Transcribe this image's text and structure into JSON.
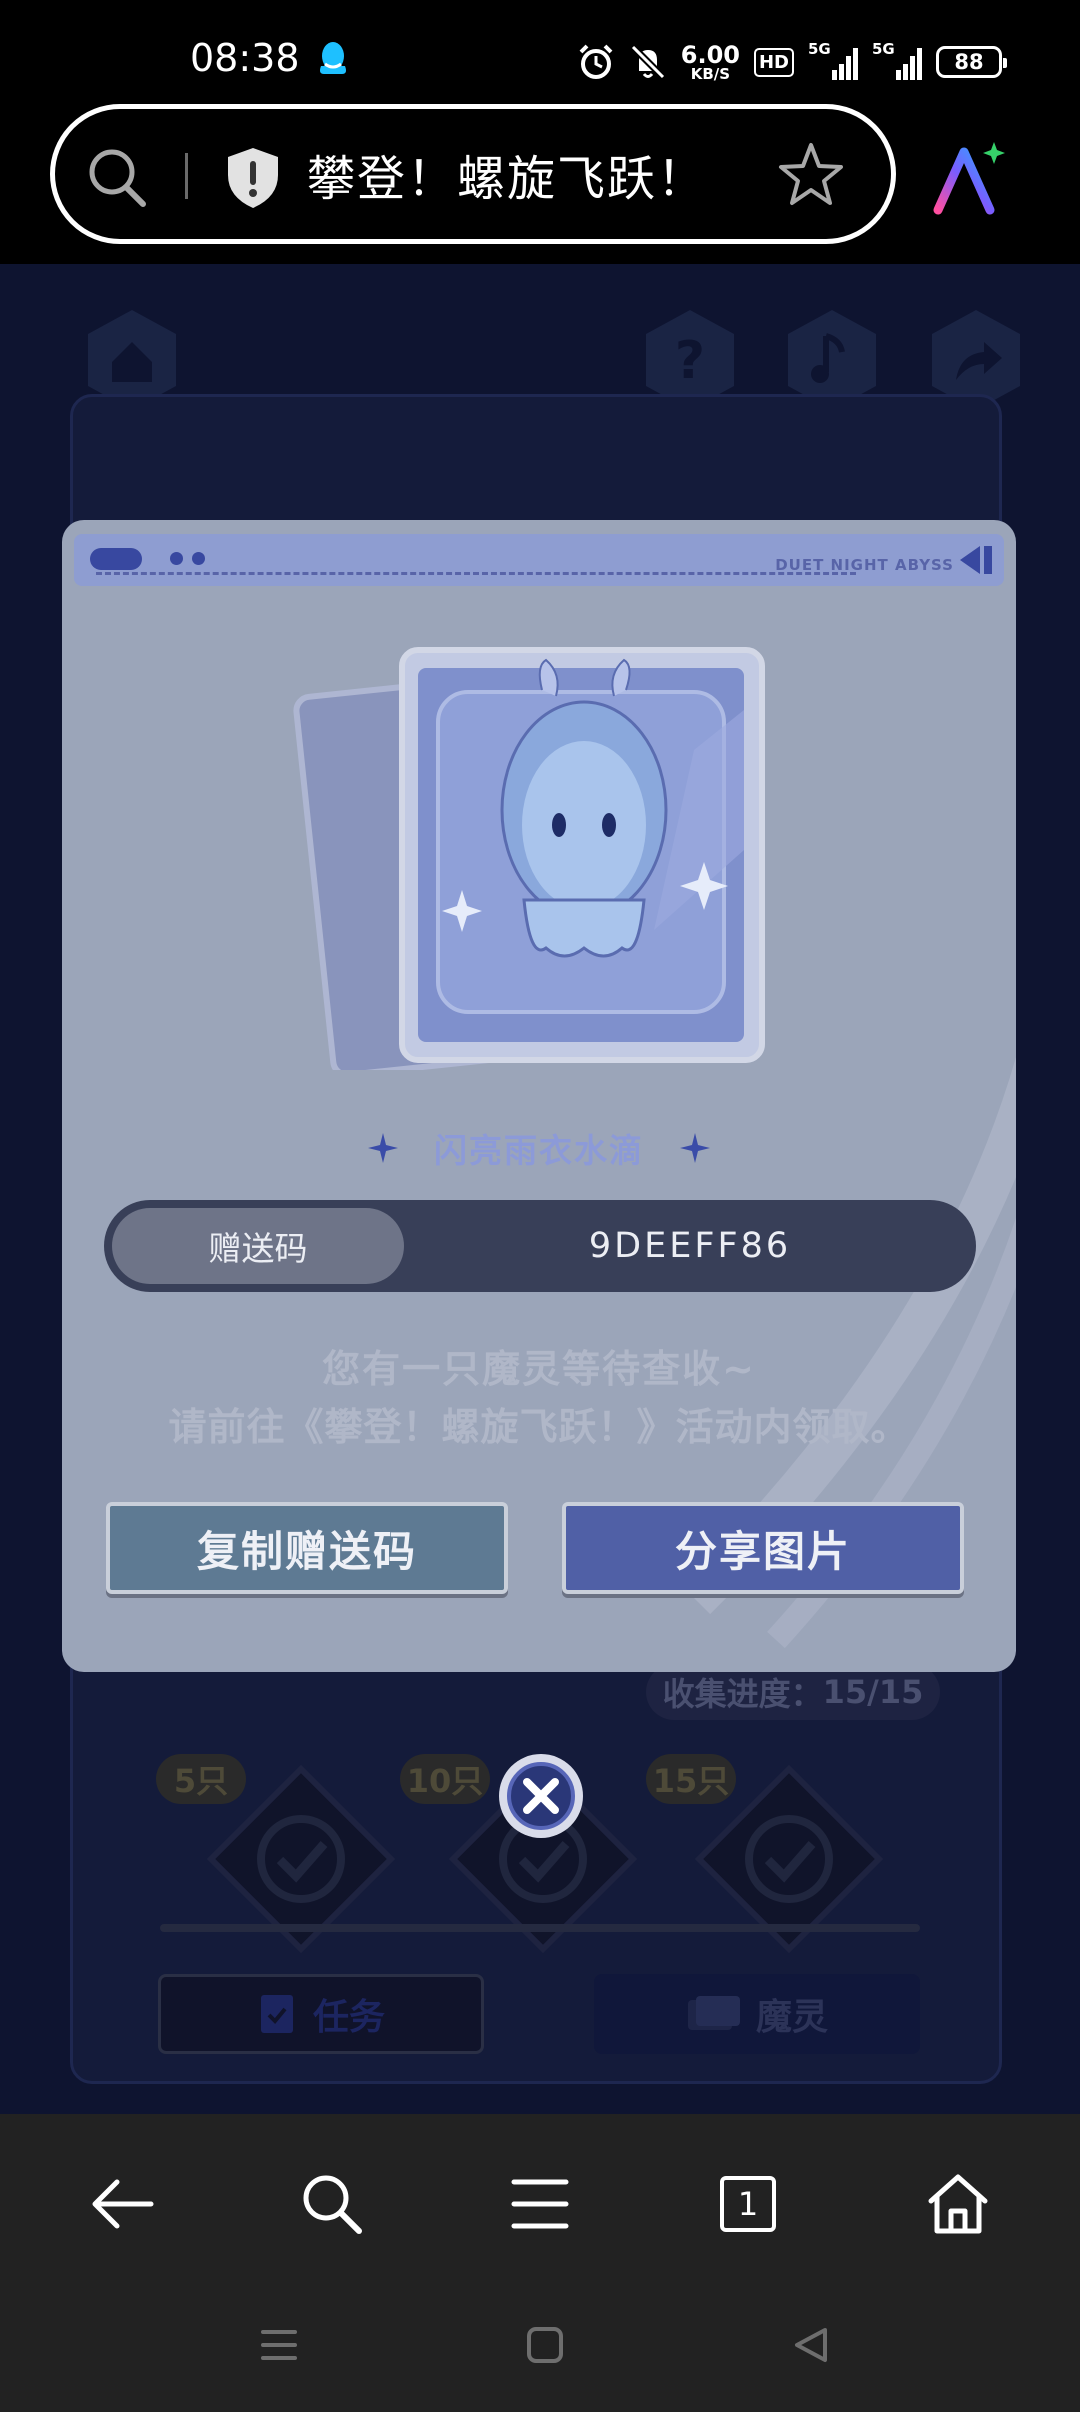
{
  "status_bar": {
    "time": "08:38",
    "speed_value": "6.00",
    "speed_unit": "KB/S",
    "hd_badge": "HD",
    "sim1_label": "5G",
    "sim2_label": "5G",
    "battery": "88",
    "icons": [
      "qq-icon",
      "alarm-icon",
      "mute-icon"
    ]
  },
  "url_bar": {
    "title": "攀登！螺旋飞跃！",
    "icons": [
      "search-icon",
      "shield-icon",
      "star-icon",
      "ai-assistant-icon"
    ]
  },
  "game": {
    "progress_label": "收集进度：",
    "progress_value": "15/15",
    "milestones": [
      "5只",
      "10只",
      "15只"
    ],
    "tab_task": "任务",
    "tab_pet": "魔灵",
    "top_icons": [
      "home-icon",
      "help-icon",
      "music-icon",
      "share-icon"
    ]
  },
  "modal": {
    "brand": "DUET NIGHT ABYSS",
    "item_name": "闪亮雨衣水滴",
    "code_label": "赠送码",
    "code_value": "9DEEFF86",
    "message_line1": "您有一只魔灵等待查收~",
    "message_line2": "请前往《攀登！螺旋飞跃！》活动内领取。",
    "copy_button": "复制赠送码",
    "share_button": "分享图片"
  },
  "bottom_nav": {
    "tab_count": "1",
    "icons": [
      "back-arrow-icon",
      "search-icon",
      "menu-icon",
      "tabs-icon",
      "home-icon"
    ]
  },
  "system_nav": {
    "icons": [
      "recent-apps-icon",
      "home-square-icon",
      "back-triangle-icon"
    ]
  },
  "colors": {
    "modal_bg": "#9ba5b9",
    "copy_button": "#5e7a93",
    "share_button": "#5060a6",
    "code_bar": "#383f58",
    "item_name": "#8c9ad8"
  }
}
